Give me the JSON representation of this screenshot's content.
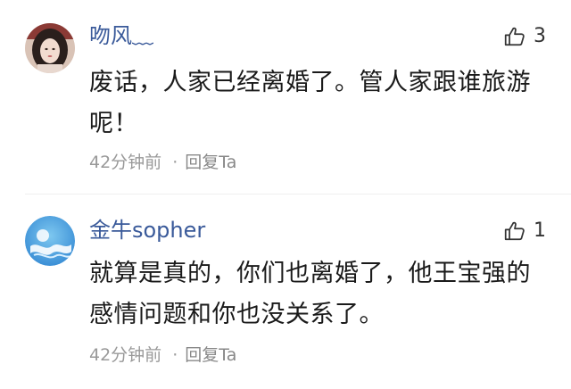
{
  "comments": [
    {
      "username": "吻风﹏",
      "like_count": "3",
      "text": "废话，人家已经离婚了。管人家跟谁旅游呢！",
      "time": "42分钟前",
      "separator": "·",
      "reply_label": "回复Ta",
      "avatar_icon": "user-photo-avatar"
    },
    {
      "username": "金牛sopher",
      "like_count": "1",
      "text": "就算是真的，你们也离婚了，他王宝强的感情问题和你也没关系了。",
      "time": "42分钟前",
      "separator": "·",
      "reply_label": "回复Ta",
      "avatar_icon": "blue-wave-avatar"
    }
  ],
  "colors": {
    "username": "#3a5a9a",
    "body_text": "#1a1a1a",
    "meta_text": "#999999"
  }
}
